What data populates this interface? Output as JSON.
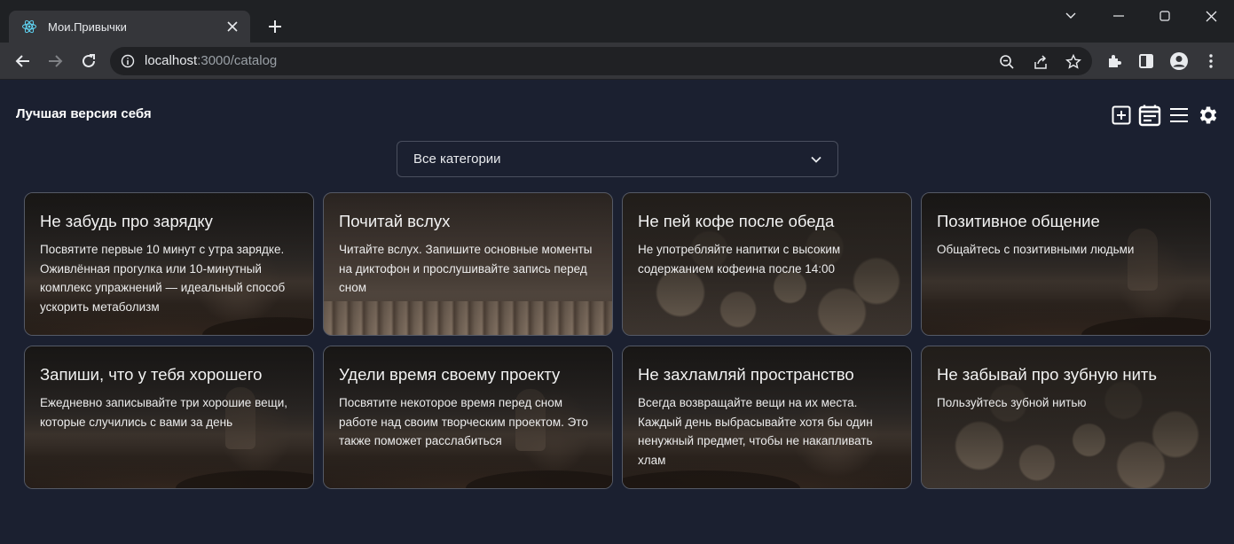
{
  "browser": {
    "tab_title": "Мои.Привычки",
    "url_host": "localhost",
    "url_rest": ":3000/catalog"
  },
  "app": {
    "brand": "Лучшая версия себя",
    "header_icons": [
      "add-box-icon",
      "calendar-list-icon",
      "menu-icon",
      "gear-icon"
    ],
    "category_select": {
      "selected": "Все категории"
    }
  },
  "cards": [
    {
      "title": "Не забудь про зарядку",
      "desc": "Посвятите первые 10 минут с утра зарядке. Оживлённая прогулка или 10-минутный комплекс упражнений — идеальный способ ускорить метаболизм",
      "bg": "sunset"
    },
    {
      "title": "Почитай вслух",
      "desc": "Читайте вслух. Запишите основные моменты на диктофон и прослушивайте запись перед сном",
      "bg": "books"
    },
    {
      "title": "Не пей кофе после обеда",
      "desc": "Не употребляйте напитки с высоким содержанием кофеина после 14:00",
      "bg": "nuts"
    },
    {
      "title": "Позитивное общение",
      "desc": "Общайтесь с позитивными людьми",
      "bg": "sunset"
    },
    {
      "title": "Запиши, что у тебя хорошего",
      "desc": "Ежедневно записывайте три хорошие вещи, которые случились с вами за день",
      "bg": "sunset"
    },
    {
      "title": "Удели время своему проекту",
      "desc": "Посвятите некоторое время перед сном работе над своим творческим проектом. Это также поможет расслабиться",
      "bg": "sunset"
    },
    {
      "title": "Не захламляй пространство",
      "desc": "Всегда возвращайте вещи на их места. Каждый день выбрасывайте хотя бы один ненужный предмет, чтобы не накапливать хлам",
      "bg": "sunset"
    },
    {
      "title": "Не забывай про зубную нить",
      "desc": "Пользуйтесь зубной нитью",
      "bg": "nuts"
    }
  ],
  "colors": {
    "page_bg": "#1b2030",
    "chrome_dark": "#1f2124",
    "chrome_toolbar": "#35363a"
  }
}
